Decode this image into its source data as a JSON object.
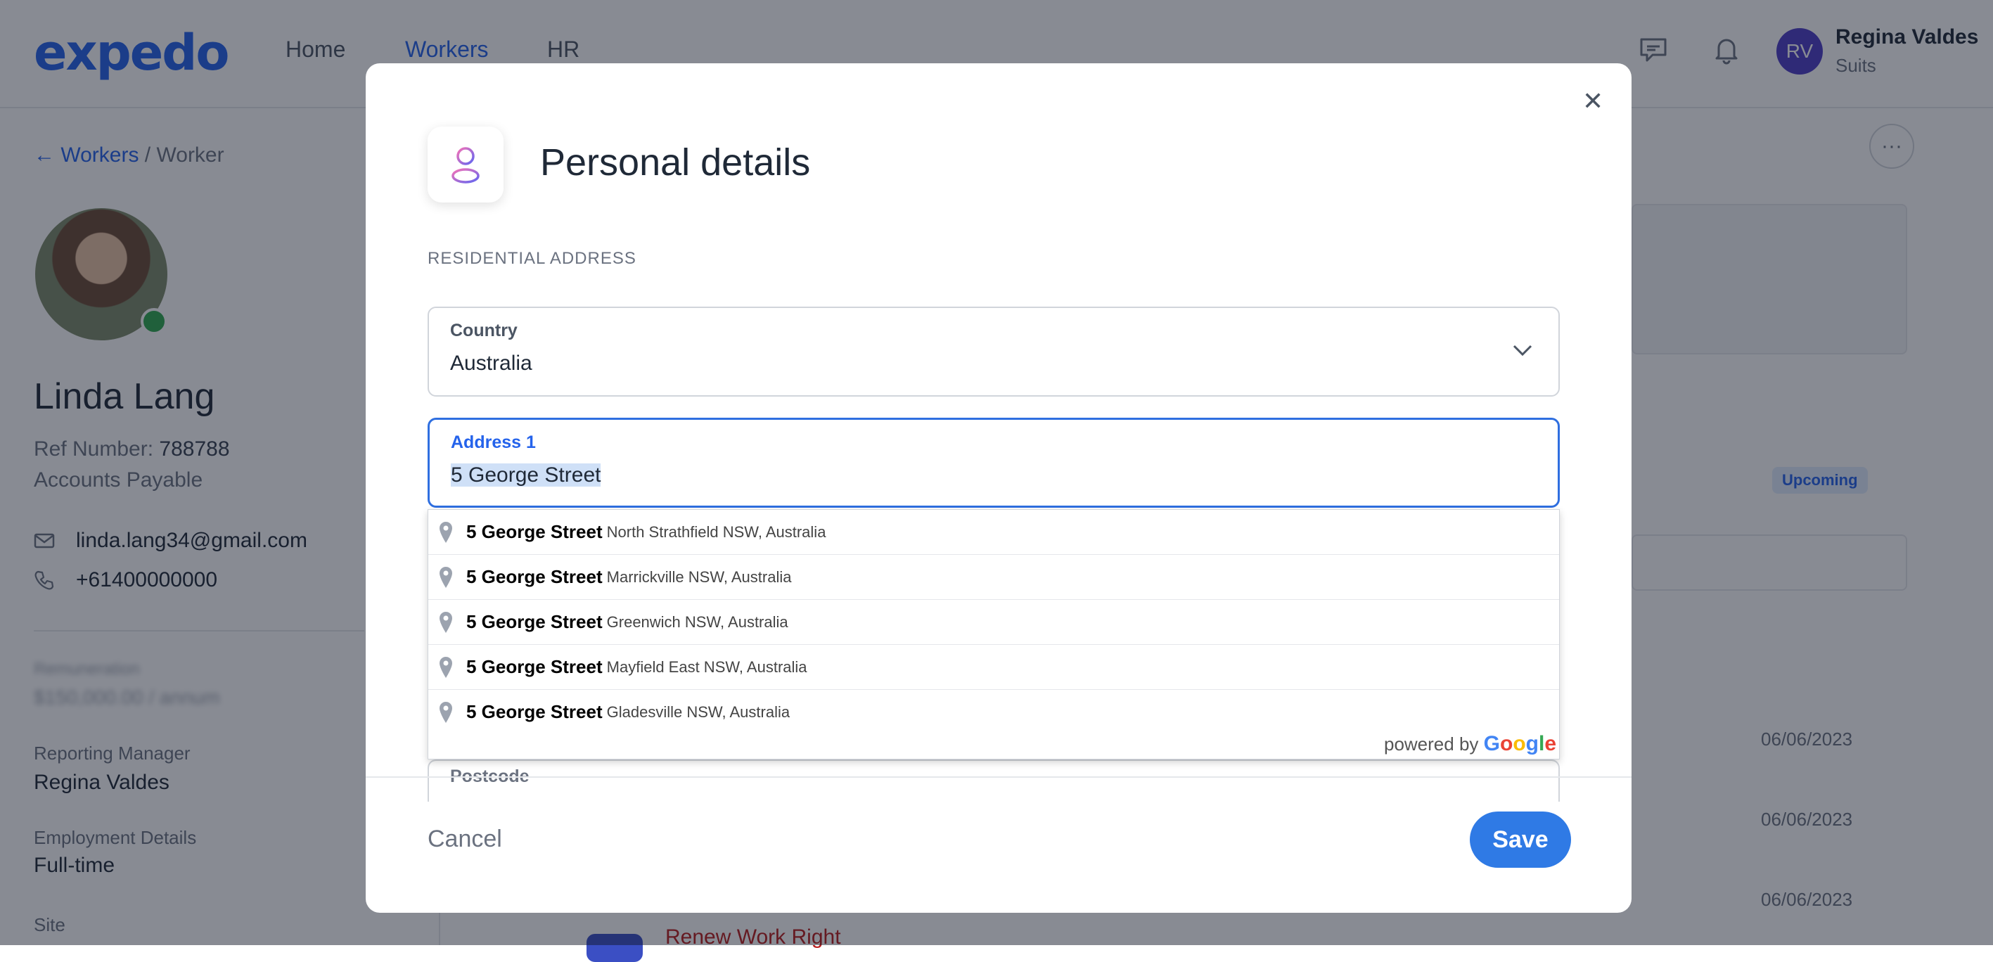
{
  "app": {
    "logo": "expedo",
    "nav": [
      "Home",
      "Workers",
      "HR"
    ],
    "user": {
      "initials": "RV",
      "name": "Regina Valdes",
      "org": "Suits"
    }
  },
  "worker": {
    "breadcrumb_back": "← Workers",
    "breadcrumb_sep": " / ",
    "breadcrumb_current": "Worker",
    "name": "Linda Lang",
    "ref_label": "Ref Number: ",
    "ref_value": "788788",
    "department": "Accounts Payable",
    "email": "linda.lang34@gmail.com",
    "phone": "+61400000000",
    "remuneration_label": "Remuneration",
    "remuneration_value": "$150,000.00 / annum",
    "reporting_manager_label": "Reporting Manager",
    "reporting_manager_value": "Regina Valdes",
    "employment_label": "Employment Details",
    "employment_value": "Full-time",
    "site_label": "Site"
  },
  "background": {
    "badge": "Upcoming",
    "dates": [
      "06/06/2023",
      "06/06/2023",
      "06/06/2023"
    ],
    "task": "Renew Work Right",
    "more": "···"
  },
  "modal": {
    "title": "Personal details",
    "section": "RESIDENTIAL ADDRESS",
    "country_label": "Country",
    "country_value": "Australia",
    "address1_label": "Address 1",
    "address1_value": "5 George Street",
    "partial_label": "Postcode",
    "suggestions": [
      {
        "main": "5 George Street",
        "secondary": "North Strathfield NSW, Australia"
      },
      {
        "main": "5 George Street",
        "secondary": "Marrickville NSW, Australia"
      },
      {
        "main": "5 George Street",
        "secondary": "Greenwich NSW, Australia"
      },
      {
        "main": "5 George Street",
        "secondary": "Mayfield East NSW, Australia"
      },
      {
        "main": "5 George Street",
        "secondary": "Gladesville NSW, Australia"
      }
    ],
    "powered_by": "powered by ",
    "google": [
      "G",
      "o",
      "o",
      "g",
      "l",
      "e"
    ],
    "cancel": "Cancel",
    "save": "Save",
    "close": "✕"
  },
  "colors": {
    "accent": "#2f7ae5",
    "overlay": "#111827",
    "upcoming": "#2563eb"
  }
}
